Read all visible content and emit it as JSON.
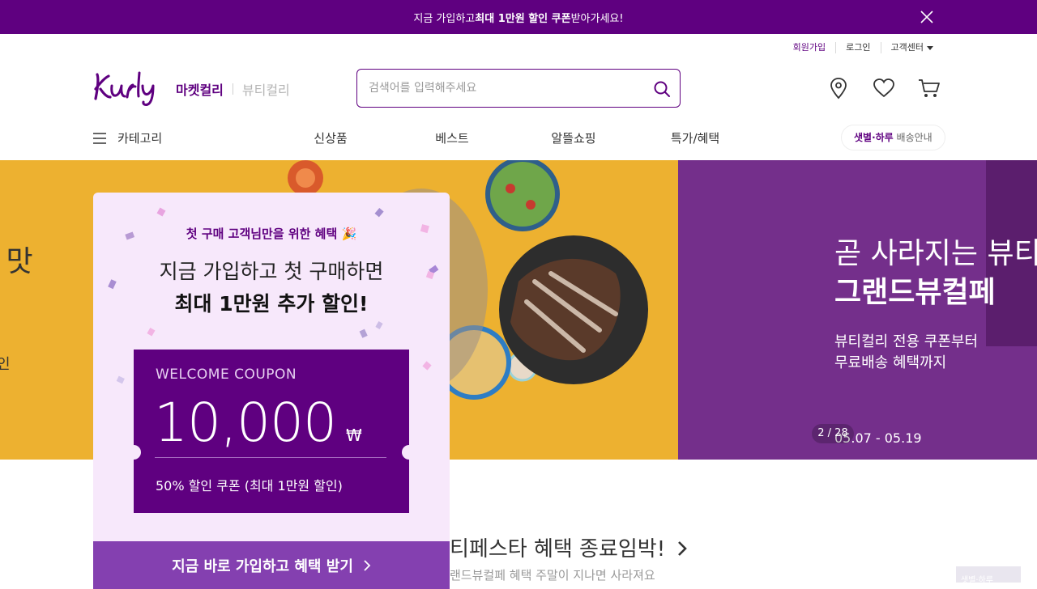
{
  "promo_bar": {
    "text_pre": "지금 가입하고 ",
    "text_bold": "최대 1만원 할인 쿠폰",
    "text_post": " 받아가세요!",
    "close_icon": "close-icon"
  },
  "util_links": {
    "signup": "회원가입",
    "login": "로그인",
    "customer_center": "고객센터"
  },
  "header": {
    "logo_text": "Kurly",
    "service_active": "마켓컬리",
    "service_inactive": "뷰티컬리",
    "search_placeholder": "검색어를 입력해주세요",
    "icons": [
      "location-icon",
      "heart-icon",
      "cart-icon"
    ]
  },
  "nav": {
    "category": "카테고리",
    "items": [
      "신상품",
      "베스트",
      "알뜰쇼핑",
      "특가/혜택"
    ],
    "delivery_bold": "샛별·하루",
    "delivery_text": " 배송안내"
  },
  "hero": {
    "left_fragments": [
      "l 맛",
      "인"
    ],
    "right_title_1": "곧 사라지는 뷰티",
    "right_title_2": "그랜드뷰컬페",
    "right_desc_1": "뷰티컬리 전용 쿠폰부터",
    "right_desc_2": "무료배송 혜택까지",
    "right_date": "05.07 - 05.19",
    "pager": "2 / 28"
  },
  "section": {
    "title": "티페스타 혜택 종료임박!",
    "subtitle": "랜드뷰컬페 혜택 주말이 지나면 사라져요",
    "thumb_text": "샛별·하루"
  },
  "coupon_modal": {
    "subtitle": "첫 구매 고객님만을 위한 혜택 🎉",
    "headline_1": "지금 가입하고 첫 구매하면",
    "headline_2": "최대 1만원 추가 할인!",
    "ticket_label": "WELCOME COUPON",
    "ticket_amount": "10,000",
    "ticket_currency": "₩",
    "ticket_desc": "50% 할인 쿠폰 (최대 1만원 할인)",
    "cta": "지금 바로 가입하고 혜택 받기"
  },
  "colors": {
    "brand_purple": "#5f0080",
    "cta_purple": "#8440b0",
    "modal_bg": "#f7e8fb",
    "hero_left": "#edb130",
    "hero_right": "#742f8b"
  }
}
